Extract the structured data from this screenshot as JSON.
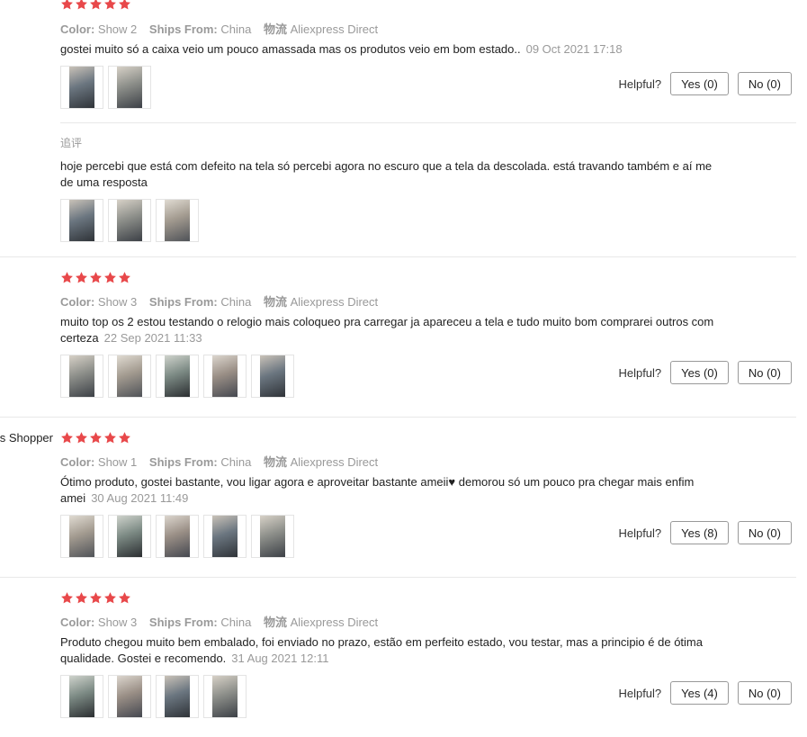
{
  "accent_star_color": "#e8484a",
  "helpful_label": "Helpful?",
  "labels": {
    "color": "Color:",
    "ships_from": "Ships From:",
    "logistics": "物流"
  },
  "reviews": [
    {
      "stars": 5,
      "color": "Show 2",
      "ships_from": "China",
      "logistics": "Aliexpress Direct",
      "text": "gostei muito só a caixa veio um pouco amassada mas os produtos veio em bom estado..",
      "date": "09 Oct 2021 17:18",
      "images": [
        "watch-photo",
        "watch-photo"
      ],
      "yes": "Yes (0)",
      "no": "No (0)",
      "followup_label": "追评",
      "followup_text": "hoje percebi que está com defeito na tela só percebi agora no escuro que a tela da descolada. está travando também e aí me de uma resposta",
      "followup_images": [
        "watch-photo",
        "watch-photo",
        "watch-photo"
      ]
    },
    {
      "stars": 5,
      "color": "Show 3",
      "ships_from": "China",
      "logistics": "Aliexpress Direct",
      "text": "muito top os 2 estou testando o relogio mais coloqueo pra carregar ja apareceu a tela e tudo muito bom comprarei outros com certeza",
      "date": "22 Sep 2021 11:33",
      "images": [
        "watch-photo",
        "watch-photo",
        "watch-photo",
        "watch-photo",
        "watch-photo"
      ],
      "yes": "Yes (0)",
      "no": "No (0)"
    },
    {
      "username": "s Shopper",
      "stars": 5,
      "color": "Show 1",
      "ships_from": "China",
      "logistics": "Aliexpress Direct",
      "text": "Ótimo produto, gostei bastante, vou ligar agora e aproveitar bastante ameii♥ demorou só um pouco pra chegar mais enfim amei",
      "date": "30 Aug 2021 11:49",
      "images": [
        "watch-photo",
        "watch-photo",
        "watch-photo",
        "watch-photo",
        "watch-photo"
      ],
      "yes": "Yes (8)",
      "no": "No (0)"
    },
    {
      "stars": 5,
      "color": "Show 3",
      "ships_from": "China",
      "logistics": "Aliexpress Direct",
      "text": "Produto chegou muito bem embalado, foi enviado no prazo, estão em perfeito estado, vou testar, mas a principio é de ótima qualidade. Gostei e recomendo.",
      "date": "31 Aug 2021 12:11",
      "images": [
        "watch-photo",
        "watch-photo",
        "watch-photo",
        "watch-photo"
      ],
      "yes": "Yes (4)",
      "no": "No (0)"
    }
  ]
}
